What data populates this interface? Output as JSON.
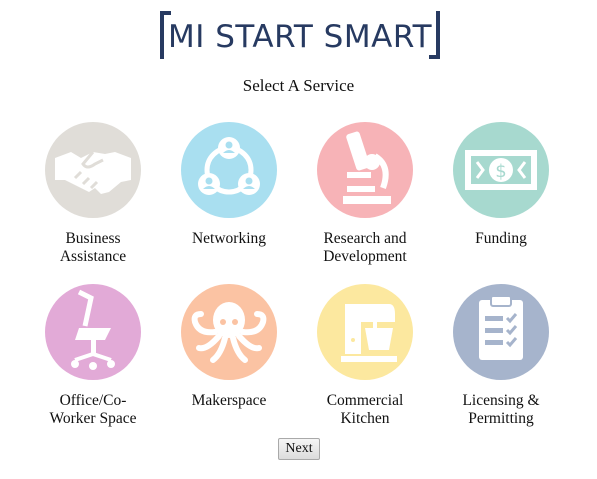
{
  "brand": {
    "title": "MI START SMART",
    "color": "#273a61"
  },
  "subtitle": "Select A Service",
  "services": [
    {
      "label_line1": "Business",
      "label_line2": "Assistance",
      "color": "#e0ddd8",
      "icon": "handshake-icon"
    },
    {
      "label_line1": "Networking",
      "label_line2": "",
      "color": "#a9dff0",
      "icon": "network-icon"
    },
    {
      "label_line1": "Research and",
      "label_line2": "Development",
      "color": "#f7b3b7",
      "icon": "microscope-icon"
    },
    {
      "label_line1": "Funding",
      "label_line2": "",
      "color": "#a7d9cf",
      "icon": "money-icon"
    },
    {
      "label_line1": "Office/Co-",
      "label_line2": "Worker Space",
      "color": "#e2aad7",
      "icon": "office-chair-icon"
    },
    {
      "label_line1": "Makerspace",
      "label_line2": "",
      "color": "#fbc3a3",
      "icon": "octopus-icon"
    },
    {
      "label_line1": "Commercial",
      "label_line2": "Kitchen",
      "color": "#fce89f",
      "icon": "stand-mixer-icon"
    },
    {
      "label_line1": "Licensing &",
      "label_line2": "Permitting",
      "color": "#a6b4cc",
      "icon": "clipboard-checklist-icon"
    }
  ],
  "next_button": {
    "label": "Next"
  }
}
